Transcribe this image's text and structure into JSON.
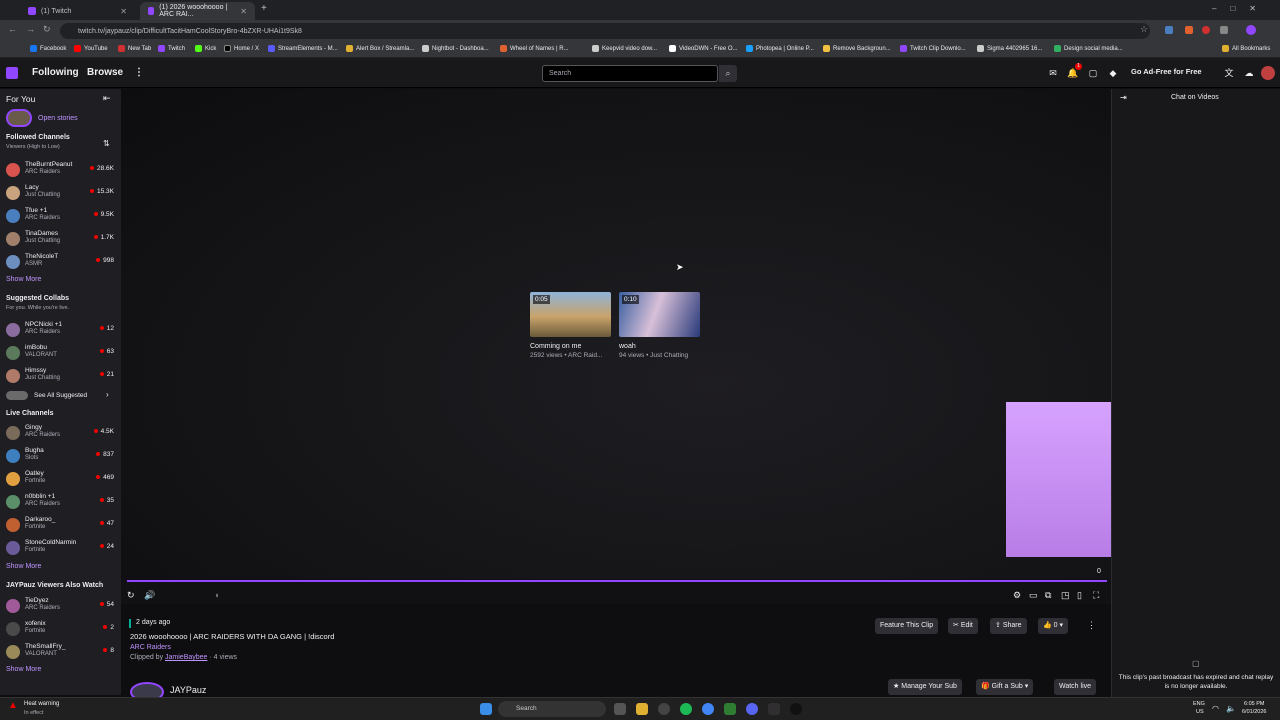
{
  "browser": {
    "tabs": [
      {
        "label": "(1) Twitch"
      },
      {
        "label": "(1) 2026 wooohoooo | ARC RAI..."
      }
    ],
    "url": "twitch.tv/jaypauz/clip/DifficultTacitHamCoolStoryBro-4bZXR-UHAi1t9Sk8",
    "bookmarks": [
      "Facebook",
      "YouTube",
      "New Tab",
      "Twitch",
      "Kick",
      "Home / X",
      "StreamElements - M...",
      "Alert Box / Streamla...",
      "Nightbot - Dashboa...",
      "Wheel of Names | R...",
      "Keepvid video dow...",
      "VideoDWN - Free O...",
      "Photopea | Online P...",
      "Remove Backgroun...",
      "Twitch Clip Downlo...",
      "Sigma 4402965 16...",
      "Design social media..."
    ],
    "all_bookmarks": "All Bookmarks"
  },
  "nav": {
    "following": "Following",
    "browse": "Browse",
    "search_placeholder": "Search",
    "ad_free": "Go Ad-Free for Free",
    "notif_count": "1"
  },
  "sidebar": {
    "for_you": "For You",
    "open_stories": "Open stories",
    "followed_title": "Followed Channels",
    "followed_sort": "Viewers (High to Low)",
    "followed": [
      {
        "name": "TheBurntPeanut",
        "game": "ARC Raiders",
        "viewers": "28.6K",
        "color": "#d9534f"
      },
      {
        "name": "Lacy",
        "game": "Just Chatting",
        "viewers": "15.3K",
        "color": "#c9a27e"
      },
      {
        "name": "Tfue +1",
        "game": "ARC Raiders",
        "viewers": "9.5K",
        "color": "#4a7fbf"
      },
      {
        "name": "TinaDames",
        "game": "Just Chatting",
        "viewers": "1.7K",
        "color": "#a0806a"
      },
      {
        "name": "TheNicoleT",
        "game": "ASMR",
        "viewers": "998",
        "color": "#6d8fbf"
      }
    ],
    "show_more": "Show More",
    "suggested_title": "Suggested Collabs",
    "suggested_sub": "For you. While you're live.",
    "suggested": [
      {
        "name": "NPCNicki +1",
        "game": "ARC Raiders",
        "viewers": "12",
        "color": "#8a6d9e"
      },
      {
        "name": "imBobu",
        "game": "VALORANT",
        "viewers": "63",
        "color": "#5b7a5b"
      },
      {
        "name": "Himssy",
        "game": "Just Chatting",
        "viewers": "21",
        "color": "#b07a6a"
      }
    ],
    "see_all": "See All Suggested",
    "live_title": "Live Channels",
    "live": [
      {
        "name": "Gingy",
        "game": "ARC Raiders",
        "viewers": "4.5K",
        "color": "#7a6a5a"
      },
      {
        "name": "Bugha",
        "game": "Slots",
        "viewers": "837",
        "color": "#3d7fbf"
      },
      {
        "name": "Oatley",
        "game": "Fortnite",
        "viewers": "469",
        "color": "#e0a040"
      },
      {
        "name": "n0bblin +1",
        "game": "ARC Raiders",
        "viewers": "35",
        "color": "#5a8f6a"
      },
      {
        "name": "Darkaroo_",
        "game": "Fortnite",
        "viewers": "47",
        "color": "#c06030"
      },
      {
        "name": "StoneColdNarmin",
        "game": "Fortnite",
        "viewers": "24",
        "color": "#6a5a9a"
      }
    ],
    "viewers_title": "JAYPauz Viewers Also Watch",
    "also": [
      {
        "name": "TieDyez",
        "game": "ARC Raiders",
        "viewers": "54",
        "color": "#a05a9a"
      },
      {
        "name": "xofenix",
        "game": "Fortnite",
        "viewers": "2",
        "color": "#4a4a4a"
      },
      {
        "name": "TheSmallFry_",
        "game": "VALORANT",
        "viewers": "8",
        "color": "#9a8a5a"
      }
    ]
  },
  "player": {
    "cards": [
      {
        "duration": "0:05",
        "title": "Comming on me",
        "meta": "2592 views • ARC Raid..."
      },
      {
        "duration": "0:10",
        "title": "woah",
        "meta": "94 views • Just Chatting"
      }
    ],
    "progress_value": "0"
  },
  "clip": {
    "date": "2 days ago",
    "title": "2026 wooohoooo | ARC RAIDERS WITH DA GANG | !discord",
    "category": "ARC Raiders",
    "clipped_by_prefix": "Clipped by",
    "clipper": "JamieBaybee",
    "views": "· 4 views",
    "feature": "Feature This Clip",
    "edit": "Edit",
    "share": "Share",
    "likes": "0",
    "channel": "JAYPauz",
    "manage_sub": "Manage Your Sub",
    "gift_sub": "Gift a Sub",
    "watch_live": "Watch live"
  },
  "chat": {
    "title": "Chat on Videos",
    "expired": "This clip's past broadcast has expired and chat replay is no longer available."
  },
  "taskbar": {
    "weather_title": "Heat warning",
    "weather_sub": "In effect",
    "search": "Search",
    "lang": "ENG",
    "region": "US",
    "time": "6:05 PM",
    "date": "6/01/2026"
  }
}
